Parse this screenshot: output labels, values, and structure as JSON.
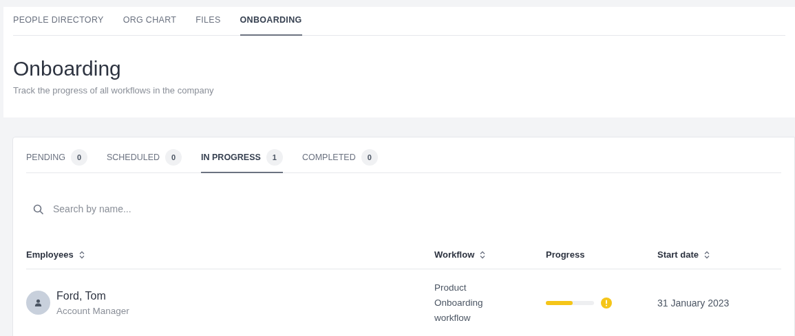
{
  "nav_tabs": [
    {
      "label": "PEOPLE DIRECTORY",
      "selected": false
    },
    {
      "label": "ORG CHART",
      "selected": false
    },
    {
      "label": "FILES",
      "selected": false
    },
    {
      "label": "ONBOARDING",
      "selected": true
    }
  ],
  "page": {
    "title": "Onboarding",
    "subtitle": "Track the progress of all workflows in the company"
  },
  "status_tabs": [
    {
      "label": "PENDING",
      "count": "0",
      "selected": false
    },
    {
      "label": "SCHEDULED",
      "count": "0",
      "selected": false
    },
    {
      "label": "IN PROGRESS",
      "count": "1",
      "selected": true
    },
    {
      "label": "COMPLETED",
      "count": "0",
      "selected": false
    }
  ],
  "search": {
    "placeholder": "Search by name..."
  },
  "table": {
    "columns": [
      {
        "label": "Employees",
        "sortable": true
      },
      {
        "label": "Workflow",
        "sortable": true
      },
      {
        "label": "Progress",
        "sortable": false
      },
      {
        "label": "Start date",
        "sortable": true
      }
    ],
    "rows": [
      {
        "name": "Ford, Tom",
        "role": "Account Manager",
        "workflow": "Product Onboarding workflow",
        "level": 0.55,
        "warning": true,
        "start_date": "31 January 2023"
      }
    ]
  }
}
